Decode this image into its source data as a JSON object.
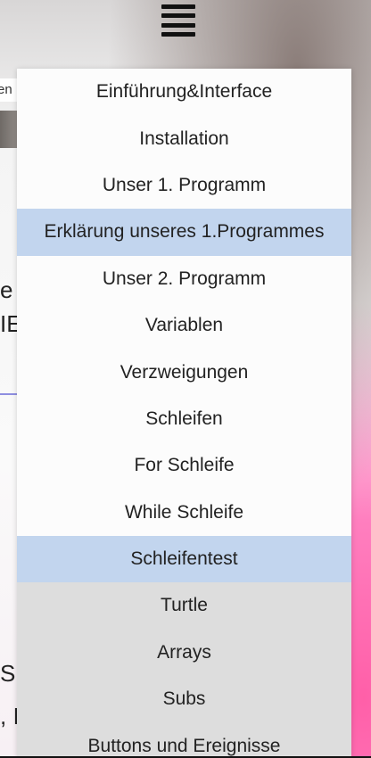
{
  "header": {
    "menu_icon": "hamburger-icon"
  },
  "background_fragments": {
    "tab_stub": "en",
    "line1": "e",
    "line2": "IE",
    "line3": "S",
    "line4": ", I"
  },
  "menu": {
    "selected_color": "#c2d5ee",
    "items": [
      {
        "label": "Einführung&Interface"
      },
      {
        "label": "Installation"
      },
      {
        "label": "Unser 1. Programm"
      },
      {
        "label": "Erklärung unseres 1.Programmes",
        "state": "selected"
      },
      {
        "label": "Unser 2. Programm"
      },
      {
        "label": "Variablen"
      },
      {
        "label": "Verzweigungen"
      },
      {
        "label": "Schleifen"
      },
      {
        "label": "For Schleife"
      },
      {
        "label": "While Schleife"
      },
      {
        "label": "Schleifentest",
        "state": "selected"
      },
      {
        "label": "Turtle",
        "state": "grey"
      },
      {
        "label": "Arrays",
        "state": "grey"
      },
      {
        "label": "Subs",
        "state": "grey"
      },
      {
        "label": "Buttons und Ereignisse",
        "state": "grey"
      }
    ]
  }
}
